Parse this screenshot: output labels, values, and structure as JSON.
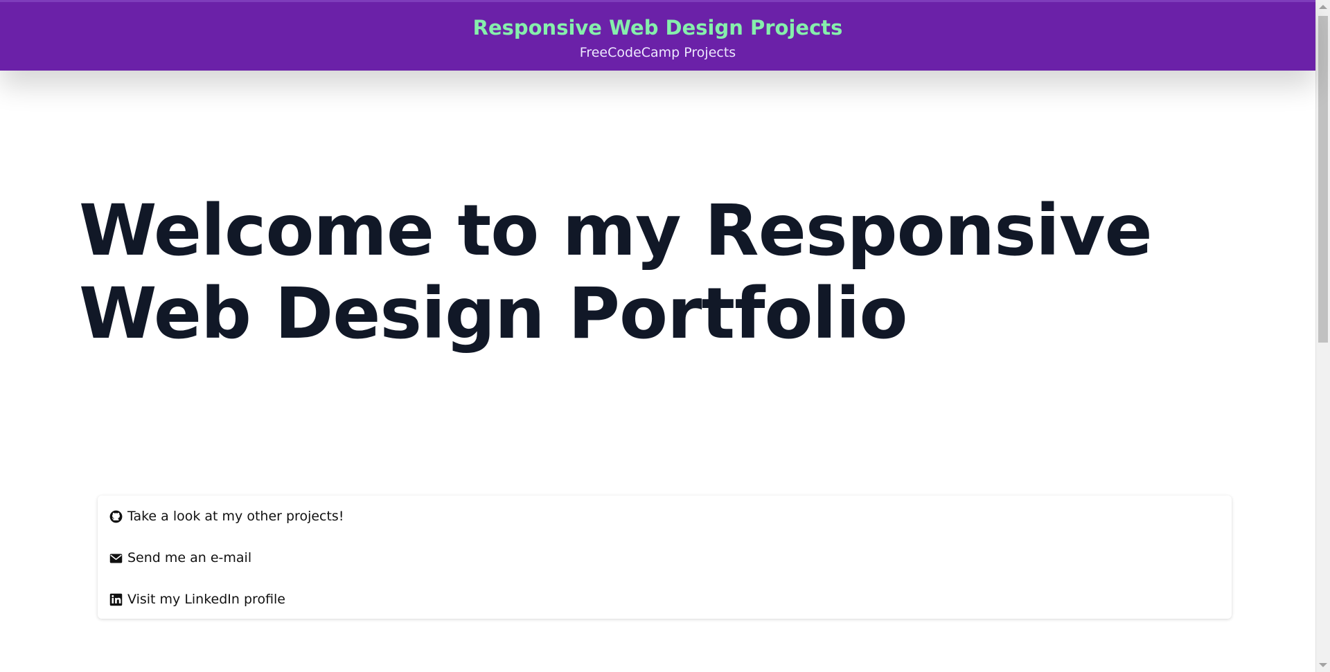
{
  "header": {
    "title": "Responsive Web Design Projects",
    "subtitle": "FreeCodeCamp Projects"
  },
  "hero": {
    "title": "Welcome to my Responsive Web Design Portfolio"
  },
  "links": [
    {
      "icon": "github-icon",
      "label": "Take a look at my other projects!"
    },
    {
      "icon": "envelope-icon",
      "label": "Send me an e-mail"
    },
    {
      "icon": "linkedin-icon",
      "label": "Visit my LinkedIn profile"
    }
  ],
  "colors": {
    "header_bg": "#6b21a8",
    "header_title": "#86efac",
    "hero_text": "#111827"
  }
}
